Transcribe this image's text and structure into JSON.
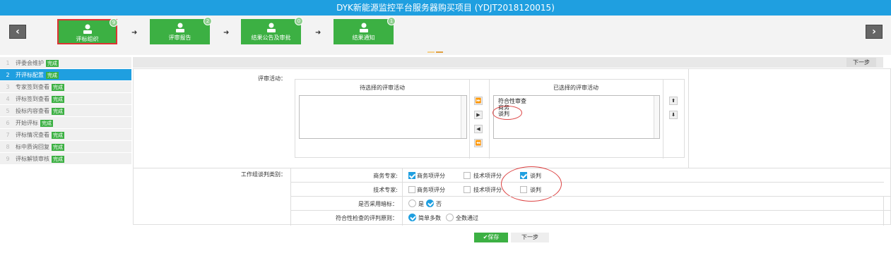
{
  "title": "DYK新能源监控平台服务器购买项目 (YDJT2018120015)",
  "nav": {
    "prev_icon": "chevron-left-icon",
    "next_icon": "chevron-right-icon"
  },
  "steps": [
    {
      "label": "评标组织",
      "badge": "9",
      "active": true
    },
    {
      "label": "评审报告",
      "badge": "2"
    },
    {
      "label": "结果公告及审批",
      "badge": "0"
    },
    {
      "label": "结果通知",
      "badge": "1"
    }
  ],
  "step_arrow": "➜",
  "sidebar": {
    "done_tag": "完成",
    "items": [
      {
        "num": "1",
        "label": "评委会维护"
      },
      {
        "num": "2",
        "label": "开评标配置"
      },
      {
        "num": "3",
        "label": "专家签到查看"
      },
      {
        "num": "4",
        "label": "评标签到查看"
      },
      {
        "num": "5",
        "label": "投标内容查看"
      },
      {
        "num": "6",
        "label": "开始评标"
      },
      {
        "num": "7",
        "label": "评标情况查看"
      },
      {
        "num": "8",
        "label": "标中质询回复"
      },
      {
        "num": "9",
        "label": "评标解锁审核"
      }
    ]
  },
  "toolbar": {
    "next_label": "下一步"
  },
  "form": {
    "activity_label": "评审活动：",
    "available_head": "待选择的评审活动",
    "selected_head": "已选择的评审活动",
    "selected_items": [
      "符合性审查",
      "商务",
      "谈判"
    ],
    "move_all_right": "⏩",
    "move_right": "▶",
    "move_left": "◀",
    "move_all_left": "⏪",
    "move_up": "⬆",
    "move_down": "⬇",
    "group_label": "工作组谈判类别：",
    "business_expert_label": "商务专家:",
    "tech_expert_label": "技术专家:",
    "opt_business_score": "商务项评分",
    "opt_tech_score": "技术项评分",
    "opt_negotiation": "谈判",
    "secret_label": "是否采用暗标：",
    "opt_yes": "是",
    "opt_no": "否",
    "rule_label": "符合性检查的评判原则：",
    "opt_majority": "简单多数",
    "opt_all": "全数通过"
  },
  "bottom": {
    "save_label": "✔保存",
    "next_label": "下一步"
  },
  "colors": {
    "primary": "#1f9fe0",
    "success": "#3cb043",
    "annotation": "#d44"
  }
}
